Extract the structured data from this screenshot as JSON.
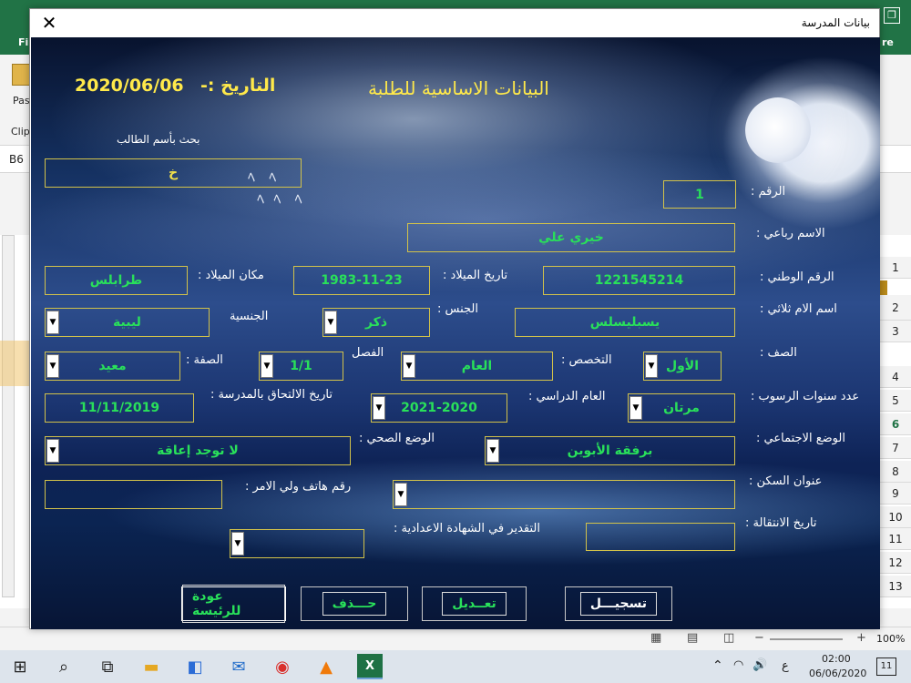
{
  "window": {
    "title": "بيانات المدرسة",
    "close": "✕"
  },
  "form": {
    "heading": "البيانات الاساسية للطلبة",
    "date_label": "التاريخ :-",
    "date_value": "2020/06/06",
    "search_label": "بحث بأسم الطالب",
    "search_value": "خ",
    "fields": {
      "number": {
        "label": "الرقم :",
        "value": "1"
      },
      "full_name": {
        "label": "الاسم رباعي :",
        "value": "خيري علي"
      },
      "national_id": {
        "label": "الرقم الوطني :",
        "value": "1221545214"
      },
      "birth_date": {
        "label": "تاريخ الميلاد :",
        "value": "1983-11-23"
      },
      "birth_place": {
        "label": "مكان الميلاد :",
        "value": "طرابلس"
      },
      "mother_name": {
        "label": "اسم الام ثلاثي :",
        "value": "يسبليسلس"
      },
      "gender": {
        "label": "الجنس :",
        "value": "ذكر"
      },
      "nationality": {
        "label": "الجنسية",
        "value": "ليبية"
      },
      "grade": {
        "label": "الصف :",
        "value": "الأول"
      },
      "specialization": {
        "label": "التخصص :",
        "value": "العام"
      },
      "class": {
        "label": "الفصل",
        "value": "1/1"
      },
      "role": {
        "label": "الصفة :",
        "value": "معيد"
      },
      "fail_years": {
        "label": "عدد سنوات الرسوب :",
        "value": "مرتان"
      },
      "academic_year": {
        "label": "العام الدراسي :",
        "value": "2021-2020"
      },
      "enroll_date": {
        "label": "تاريخ الالتحاق بالمدرسة :",
        "value": "11/11/2019"
      },
      "social_status": {
        "label": "الوضع الاجتماعي :",
        "value": "برفقة الأبوين"
      },
      "health_status": {
        "label": "الوضع الصحي :",
        "value": "لا توجد إعاقة"
      },
      "address": {
        "label": "عنوان السكن :",
        "value": ""
      },
      "guardian_phone": {
        "label": "رقم هاتف ولي الامر :",
        "value": ""
      },
      "transfer_date": {
        "label": "تاريخ الانتقالة :",
        "value": ""
      },
      "prep_grade": {
        "label": "التقدير في الشهادة الاعدادية :",
        "value": ""
      }
    },
    "buttons": {
      "register": "تسجيـــل",
      "edit": "تعــديل",
      "delete": "حـــذف",
      "home": "عودة للرئيسة"
    }
  },
  "excel": {
    "tab_left": "Fil",
    "tab_right": "re",
    "paste": "Pas",
    "clipboard": "Clip",
    "cell_ref": "B6",
    "rows": [
      "1",
      "2",
      "3",
      "4",
      "5",
      "6",
      "7",
      "8",
      "9",
      "10",
      "11",
      "12",
      "13"
    ],
    "zoom": "100%"
  },
  "taskbar": {
    "time": "02:00",
    "date": "06/06/2020",
    "lang": "ع",
    "notifications": "11"
  }
}
